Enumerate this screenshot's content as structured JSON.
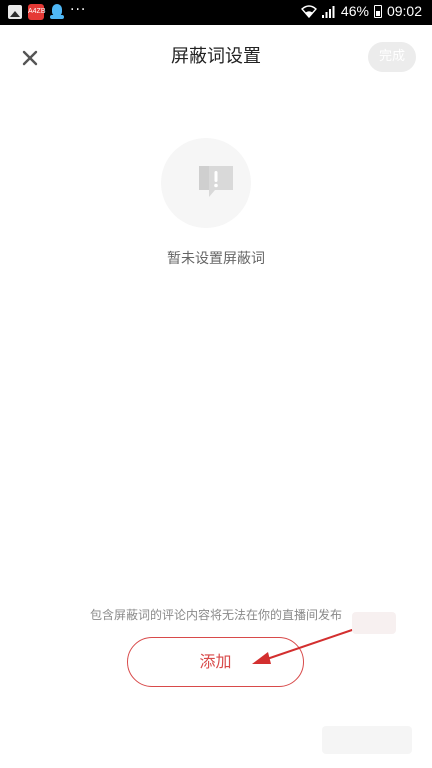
{
  "status_bar": {
    "app_icon_label": "A4ZB",
    "more": "···",
    "battery": "46%",
    "time": "09:02",
    "icons": [
      "gallery-icon",
      "app-icon",
      "qq-icon",
      "wifi-icon",
      "signal-icon",
      "battery-icon"
    ]
  },
  "header": {
    "title": "屏蔽词设置",
    "done_label": "完成",
    "close_icon": "close-icon"
  },
  "empty_state": {
    "icon": "empty-alert-icon",
    "text": "暂未设置屏蔽词"
  },
  "footer": {
    "hint": "包含屏蔽词的评论内容将无法在你的直播间发布",
    "add_label": "添加"
  },
  "colors": {
    "accent": "#d84a4a",
    "annotation": "#d32f2f",
    "done_bg": "#ececec",
    "status_bar_bg": "#000000"
  }
}
